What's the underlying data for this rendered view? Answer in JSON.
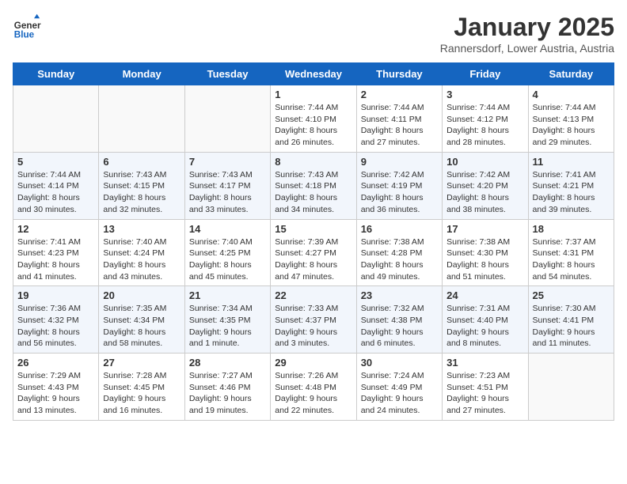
{
  "header": {
    "logo_general": "General",
    "logo_blue": "Blue",
    "month_title": "January 2025",
    "location": "Rannersdorf, Lower Austria, Austria"
  },
  "weekdays": [
    "Sunday",
    "Monday",
    "Tuesday",
    "Wednesday",
    "Thursday",
    "Friday",
    "Saturday"
  ],
  "weeks": [
    [
      {
        "day": "",
        "info": ""
      },
      {
        "day": "",
        "info": ""
      },
      {
        "day": "",
        "info": ""
      },
      {
        "day": "1",
        "info": "Sunrise: 7:44 AM\nSunset: 4:10 PM\nDaylight: 8 hours and 26 minutes."
      },
      {
        "day": "2",
        "info": "Sunrise: 7:44 AM\nSunset: 4:11 PM\nDaylight: 8 hours and 27 minutes."
      },
      {
        "day": "3",
        "info": "Sunrise: 7:44 AM\nSunset: 4:12 PM\nDaylight: 8 hours and 28 minutes."
      },
      {
        "day": "4",
        "info": "Sunrise: 7:44 AM\nSunset: 4:13 PM\nDaylight: 8 hours and 29 minutes."
      }
    ],
    [
      {
        "day": "5",
        "info": "Sunrise: 7:44 AM\nSunset: 4:14 PM\nDaylight: 8 hours and 30 minutes."
      },
      {
        "day": "6",
        "info": "Sunrise: 7:43 AM\nSunset: 4:15 PM\nDaylight: 8 hours and 32 minutes."
      },
      {
        "day": "7",
        "info": "Sunrise: 7:43 AM\nSunset: 4:17 PM\nDaylight: 8 hours and 33 minutes."
      },
      {
        "day": "8",
        "info": "Sunrise: 7:43 AM\nSunset: 4:18 PM\nDaylight: 8 hours and 34 minutes."
      },
      {
        "day": "9",
        "info": "Sunrise: 7:42 AM\nSunset: 4:19 PM\nDaylight: 8 hours and 36 minutes."
      },
      {
        "day": "10",
        "info": "Sunrise: 7:42 AM\nSunset: 4:20 PM\nDaylight: 8 hours and 38 minutes."
      },
      {
        "day": "11",
        "info": "Sunrise: 7:41 AM\nSunset: 4:21 PM\nDaylight: 8 hours and 39 minutes."
      }
    ],
    [
      {
        "day": "12",
        "info": "Sunrise: 7:41 AM\nSunset: 4:23 PM\nDaylight: 8 hours and 41 minutes."
      },
      {
        "day": "13",
        "info": "Sunrise: 7:40 AM\nSunset: 4:24 PM\nDaylight: 8 hours and 43 minutes."
      },
      {
        "day": "14",
        "info": "Sunrise: 7:40 AM\nSunset: 4:25 PM\nDaylight: 8 hours and 45 minutes."
      },
      {
        "day": "15",
        "info": "Sunrise: 7:39 AM\nSunset: 4:27 PM\nDaylight: 8 hours and 47 minutes."
      },
      {
        "day": "16",
        "info": "Sunrise: 7:38 AM\nSunset: 4:28 PM\nDaylight: 8 hours and 49 minutes."
      },
      {
        "day": "17",
        "info": "Sunrise: 7:38 AM\nSunset: 4:30 PM\nDaylight: 8 hours and 51 minutes."
      },
      {
        "day": "18",
        "info": "Sunrise: 7:37 AM\nSunset: 4:31 PM\nDaylight: 8 hours and 54 minutes."
      }
    ],
    [
      {
        "day": "19",
        "info": "Sunrise: 7:36 AM\nSunset: 4:32 PM\nDaylight: 8 hours and 56 minutes."
      },
      {
        "day": "20",
        "info": "Sunrise: 7:35 AM\nSunset: 4:34 PM\nDaylight: 8 hours and 58 minutes."
      },
      {
        "day": "21",
        "info": "Sunrise: 7:34 AM\nSunset: 4:35 PM\nDaylight: 9 hours and 1 minute."
      },
      {
        "day": "22",
        "info": "Sunrise: 7:33 AM\nSunset: 4:37 PM\nDaylight: 9 hours and 3 minutes."
      },
      {
        "day": "23",
        "info": "Sunrise: 7:32 AM\nSunset: 4:38 PM\nDaylight: 9 hours and 6 minutes."
      },
      {
        "day": "24",
        "info": "Sunrise: 7:31 AM\nSunset: 4:40 PM\nDaylight: 9 hours and 8 minutes."
      },
      {
        "day": "25",
        "info": "Sunrise: 7:30 AM\nSunset: 4:41 PM\nDaylight: 9 hours and 11 minutes."
      }
    ],
    [
      {
        "day": "26",
        "info": "Sunrise: 7:29 AM\nSunset: 4:43 PM\nDaylight: 9 hours and 13 minutes."
      },
      {
        "day": "27",
        "info": "Sunrise: 7:28 AM\nSunset: 4:45 PM\nDaylight: 9 hours and 16 minutes."
      },
      {
        "day": "28",
        "info": "Sunrise: 7:27 AM\nSunset: 4:46 PM\nDaylight: 9 hours and 19 minutes."
      },
      {
        "day": "29",
        "info": "Sunrise: 7:26 AM\nSunset: 4:48 PM\nDaylight: 9 hours and 22 minutes."
      },
      {
        "day": "30",
        "info": "Sunrise: 7:24 AM\nSunset: 4:49 PM\nDaylight: 9 hours and 24 minutes."
      },
      {
        "day": "31",
        "info": "Sunrise: 7:23 AM\nSunset: 4:51 PM\nDaylight: 9 hours and 27 minutes."
      },
      {
        "day": "",
        "info": ""
      }
    ]
  ]
}
